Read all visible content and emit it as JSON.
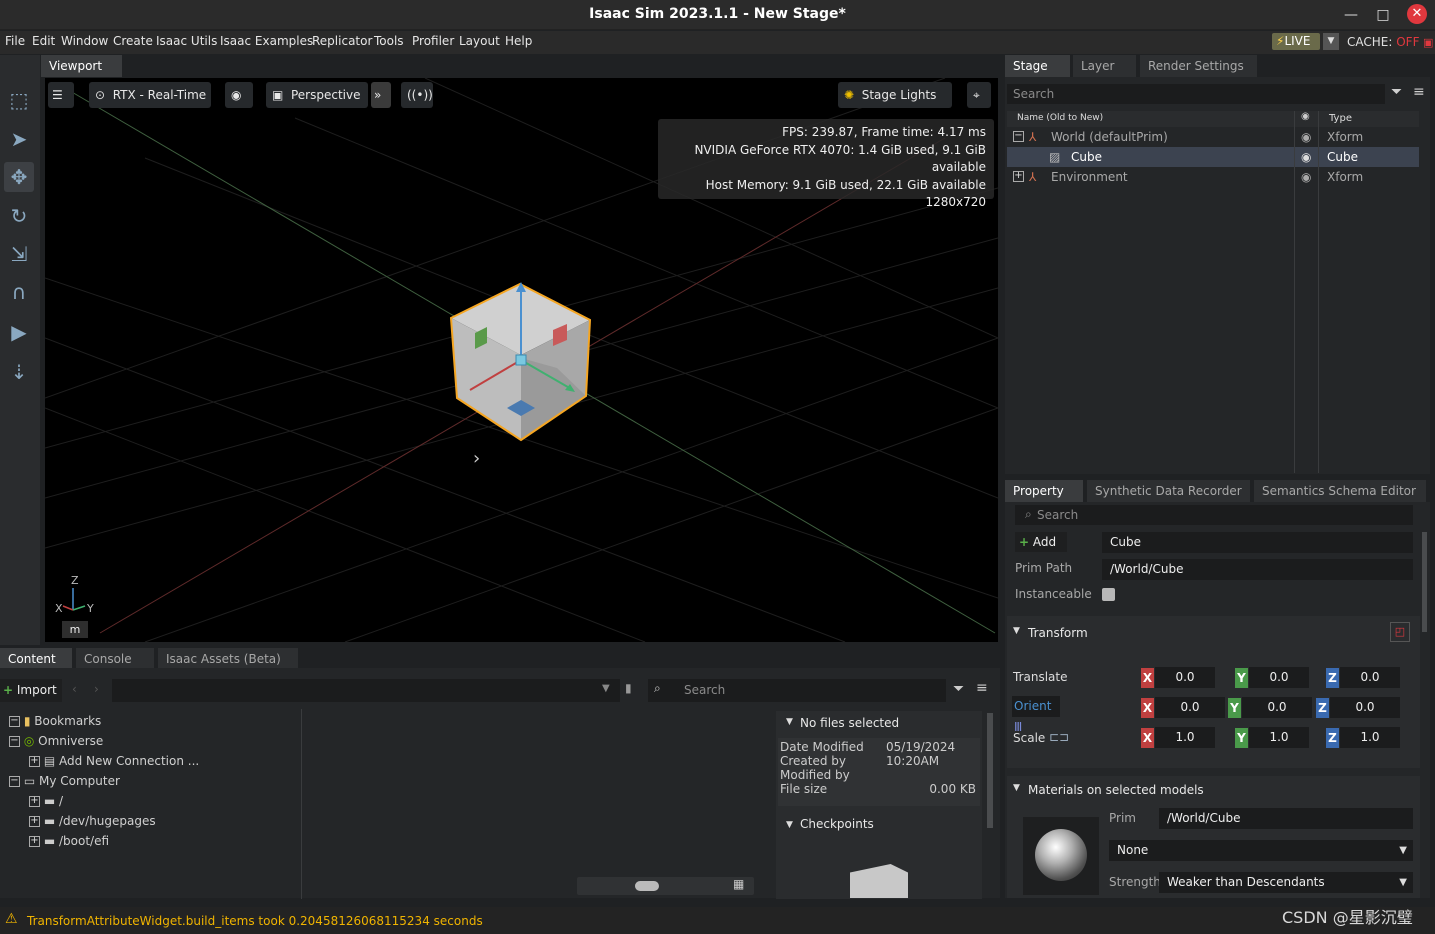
{
  "window": {
    "title": "Isaac Sim 2023.1.1 - New Stage*",
    "minimize": "—",
    "maximize": "□",
    "close": "✕"
  },
  "menu": [
    "File",
    "Edit",
    "Window",
    "Create",
    "Isaac Utils",
    "Isaac Examples",
    "Replicator",
    "Tools",
    "Profiler",
    "Layout",
    "Help"
  ],
  "live": {
    "label": "LIVE",
    "cache_label": "CACHE:",
    "cache_state": "OFF"
  },
  "viewport": {
    "tab": "Viewport",
    "render_mode": "RTX - Real-Time",
    "camera": "Perspective",
    "lights": "Stage Lights",
    "stats": [
      "FPS: 239.87, Frame time: 4.17 ms",
      "NVIDIA GeForce RTX 4070: 1.4 GiB used, 9.1 GiB available",
      "Host Memory: 9.1 GiB used, 22.1 GiB available",
      "1280x720"
    ],
    "units": "m",
    "axes": {
      "x": "X",
      "y": "Y",
      "z": "Z"
    }
  },
  "stage": {
    "tabs": [
      "Stage",
      "Layer",
      "Render Settings"
    ],
    "search_placeholder": "Search",
    "columns": {
      "name": "Name (Old to New)",
      "type": "Type"
    },
    "rows": [
      {
        "name": "World (defaultPrim)",
        "type": "Xform"
      },
      {
        "name": "Cube",
        "type": "Cube"
      },
      {
        "name": "Environment",
        "type": "Xform"
      }
    ]
  },
  "property": {
    "tabs": [
      "Property",
      "Synthetic Data Recorder",
      "Semantics Schema Editor"
    ],
    "search_placeholder": "Search",
    "add_label": "Add",
    "name_value": "Cube",
    "prim_path_label": "Prim Path",
    "prim_path": "/World/Cube",
    "instanceable_label": "Instanceable",
    "transform_label": "Transform",
    "translate_label": "Translate",
    "orient_label": "Orient",
    "scale_label": "Scale",
    "translate": {
      "x": "0.0",
      "y": "0.0",
      "z": "0.0"
    },
    "orient": {
      "x": "0.0",
      "y": "0.0",
      "z": "0.0"
    },
    "scale": {
      "x": "1.0",
      "y": "1.0",
      "z": "1.0"
    },
    "materials_label": "Materials on selected models",
    "prim_label": "Prim",
    "prim_value": "/World/Cube",
    "material_value": "None",
    "strength_label": "Strength",
    "strength_value": "Weaker than Descendants"
  },
  "content": {
    "tabs": [
      "Content",
      "Console",
      "Isaac Assets (Beta)"
    ],
    "import_label": "Import",
    "search_placeholder": "Search",
    "tree": [
      {
        "label": "Bookmarks"
      },
      {
        "label": "Omniverse"
      },
      {
        "label": "Add New Connection ..."
      },
      {
        "label": "My Computer"
      },
      {
        "label": "/"
      },
      {
        "label": "/dev/hugepages"
      },
      {
        "label": "/boot/efi"
      }
    ],
    "details_header": "No files selected",
    "date_modified_label": "Date Modified",
    "date_modified": "05/19/2024 10:20AM",
    "created_by_label": "Created by",
    "modified_by_label": "Modified by",
    "file_size_label": "File size",
    "file_size": "0.00 KB",
    "checkpoints_label": "Checkpoints"
  },
  "status": {
    "message": "TransformAttributeWidget.build_items took 0.20458126068115234 seconds"
  },
  "watermark": "CSDN @星影沉璧"
}
